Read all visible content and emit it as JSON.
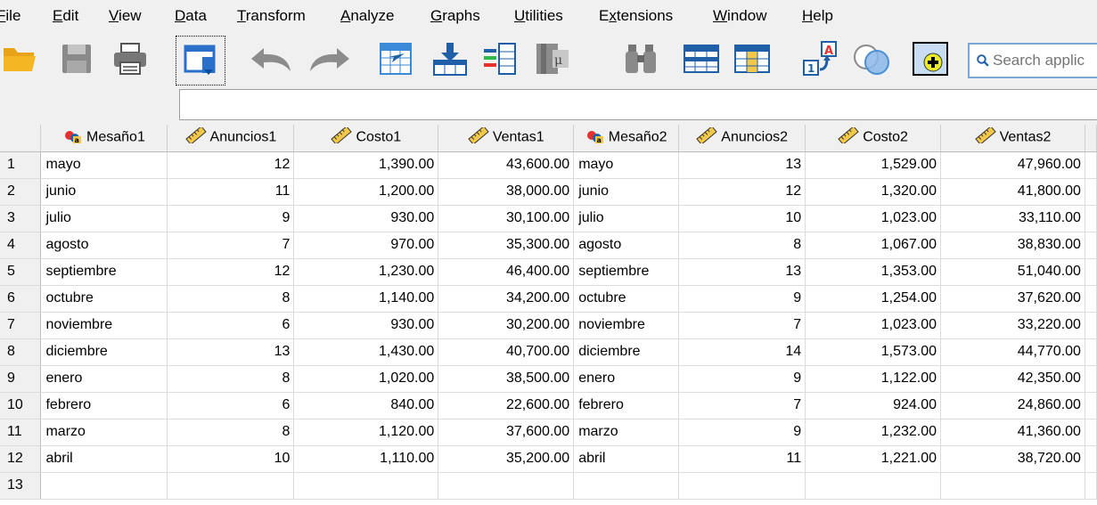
{
  "menu": [
    "File",
    "Edit",
    "View",
    "Data",
    "Transform",
    "Analyze",
    "Graphs",
    "Utilities",
    "Extensions",
    "Window",
    "Help"
  ],
  "menu_mnemonics": [
    "F",
    "E",
    "V",
    "D",
    "T",
    "A",
    "G",
    "U",
    "x",
    "W",
    "H"
  ],
  "search": {
    "placeholder": "Search applic"
  },
  "columns": [
    {
      "name": "Mesaño1",
      "type": "nominal",
      "icon": "nominal-variable-icon"
    },
    {
      "name": "Anuncios1",
      "type": "scale",
      "icon": "scale-ruler-icon"
    },
    {
      "name": "Costo1",
      "type": "scale",
      "icon": "scale-ruler-icon"
    },
    {
      "name": "Ventas1",
      "type": "scale",
      "icon": "scale-ruler-icon"
    },
    {
      "name": "Mesaño2",
      "type": "nominal",
      "icon": "nominal-variable-icon"
    },
    {
      "name": "Anuncios2",
      "type": "scale",
      "icon": "scale-ruler-icon"
    },
    {
      "name": "Costo2",
      "type": "scale",
      "icon": "scale-ruler-icon"
    },
    {
      "name": "Ventas2",
      "type": "scale",
      "icon": "scale-ruler-icon"
    }
  ],
  "rows": [
    [
      "1",
      "mayo",
      "12",
      "1,390.00",
      "43,600.00",
      "mayo",
      "13",
      "1,529.00",
      "47,960.00"
    ],
    [
      "2",
      "junio",
      "11",
      "1,200.00",
      "38,000.00",
      "junio",
      "12",
      "1,320.00",
      "41,800.00"
    ],
    [
      "3",
      "julio",
      "9",
      "930.00",
      "30,100.00",
      "julio",
      "10",
      "1,023.00",
      "33,110.00"
    ],
    [
      "4",
      "agosto",
      "7",
      "970.00",
      "35,300.00",
      "agosto",
      "8",
      "1,067.00",
      "38,830.00"
    ],
    [
      "5",
      "septiembre",
      "12",
      "1,230.00",
      "46,400.00",
      "septiembre",
      "13",
      "1,353.00",
      "51,040.00"
    ],
    [
      "6",
      "octubre",
      "8",
      "1,140.00",
      "34,200.00",
      "octubre",
      "9",
      "1,254.00",
      "37,620.00"
    ],
    [
      "7",
      "noviembre",
      "6",
      "930.00",
      "30,200.00",
      "noviembre",
      "7",
      "1,023.00",
      "33,220.00"
    ],
    [
      "8",
      "diciembre",
      "13",
      "1,430.00",
      "40,700.00",
      "diciembre",
      "14",
      "1,573.00",
      "44,770.00"
    ],
    [
      "9",
      "enero",
      "8",
      "1,020.00",
      "38,500.00",
      "enero",
      "9",
      "1,122.00",
      "42,350.00"
    ],
    [
      "10",
      "febrero",
      "6",
      "840.00",
      "22,600.00",
      "febrero",
      "7",
      "924.00",
      "24,860.00"
    ],
    [
      "11",
      "marzo",
      "8",
      "1,120.00",
      "37,600.00",
      "marzo",
      "9",
      "1,232.00",
      "41,360.00"
    ],
    [
      "12",
      "abril",
      "10",
      "1,110.00",
      "35,200.00",
      "abril",
      "11",
      "1,221.00",
      "38,720.00"
    ],
    [
      "13",
      "",
      "",
      "",
      "",
      "",
      "",
      "",
      ""
    ]
  ],
  "toolbar_icons": [
    "open-folder-icon",
    "save-disk-icon",
    "print-icon",
    "recall-dialog-icon",
    "undo-icon",
    "redo-icon",
    "go-to-case-icon",
    "go-to-variable-icon",
    "variables-icon",
    "run-descriptives-icon",
    "find-binoculars-icon",
    "insert-cases-icon",
    "insert-variable-icon",
    "split-file-icon",
    "value-labels-icon",
    "use-sets-icon",
    "customize-toolbar-icon"
  ]
}
